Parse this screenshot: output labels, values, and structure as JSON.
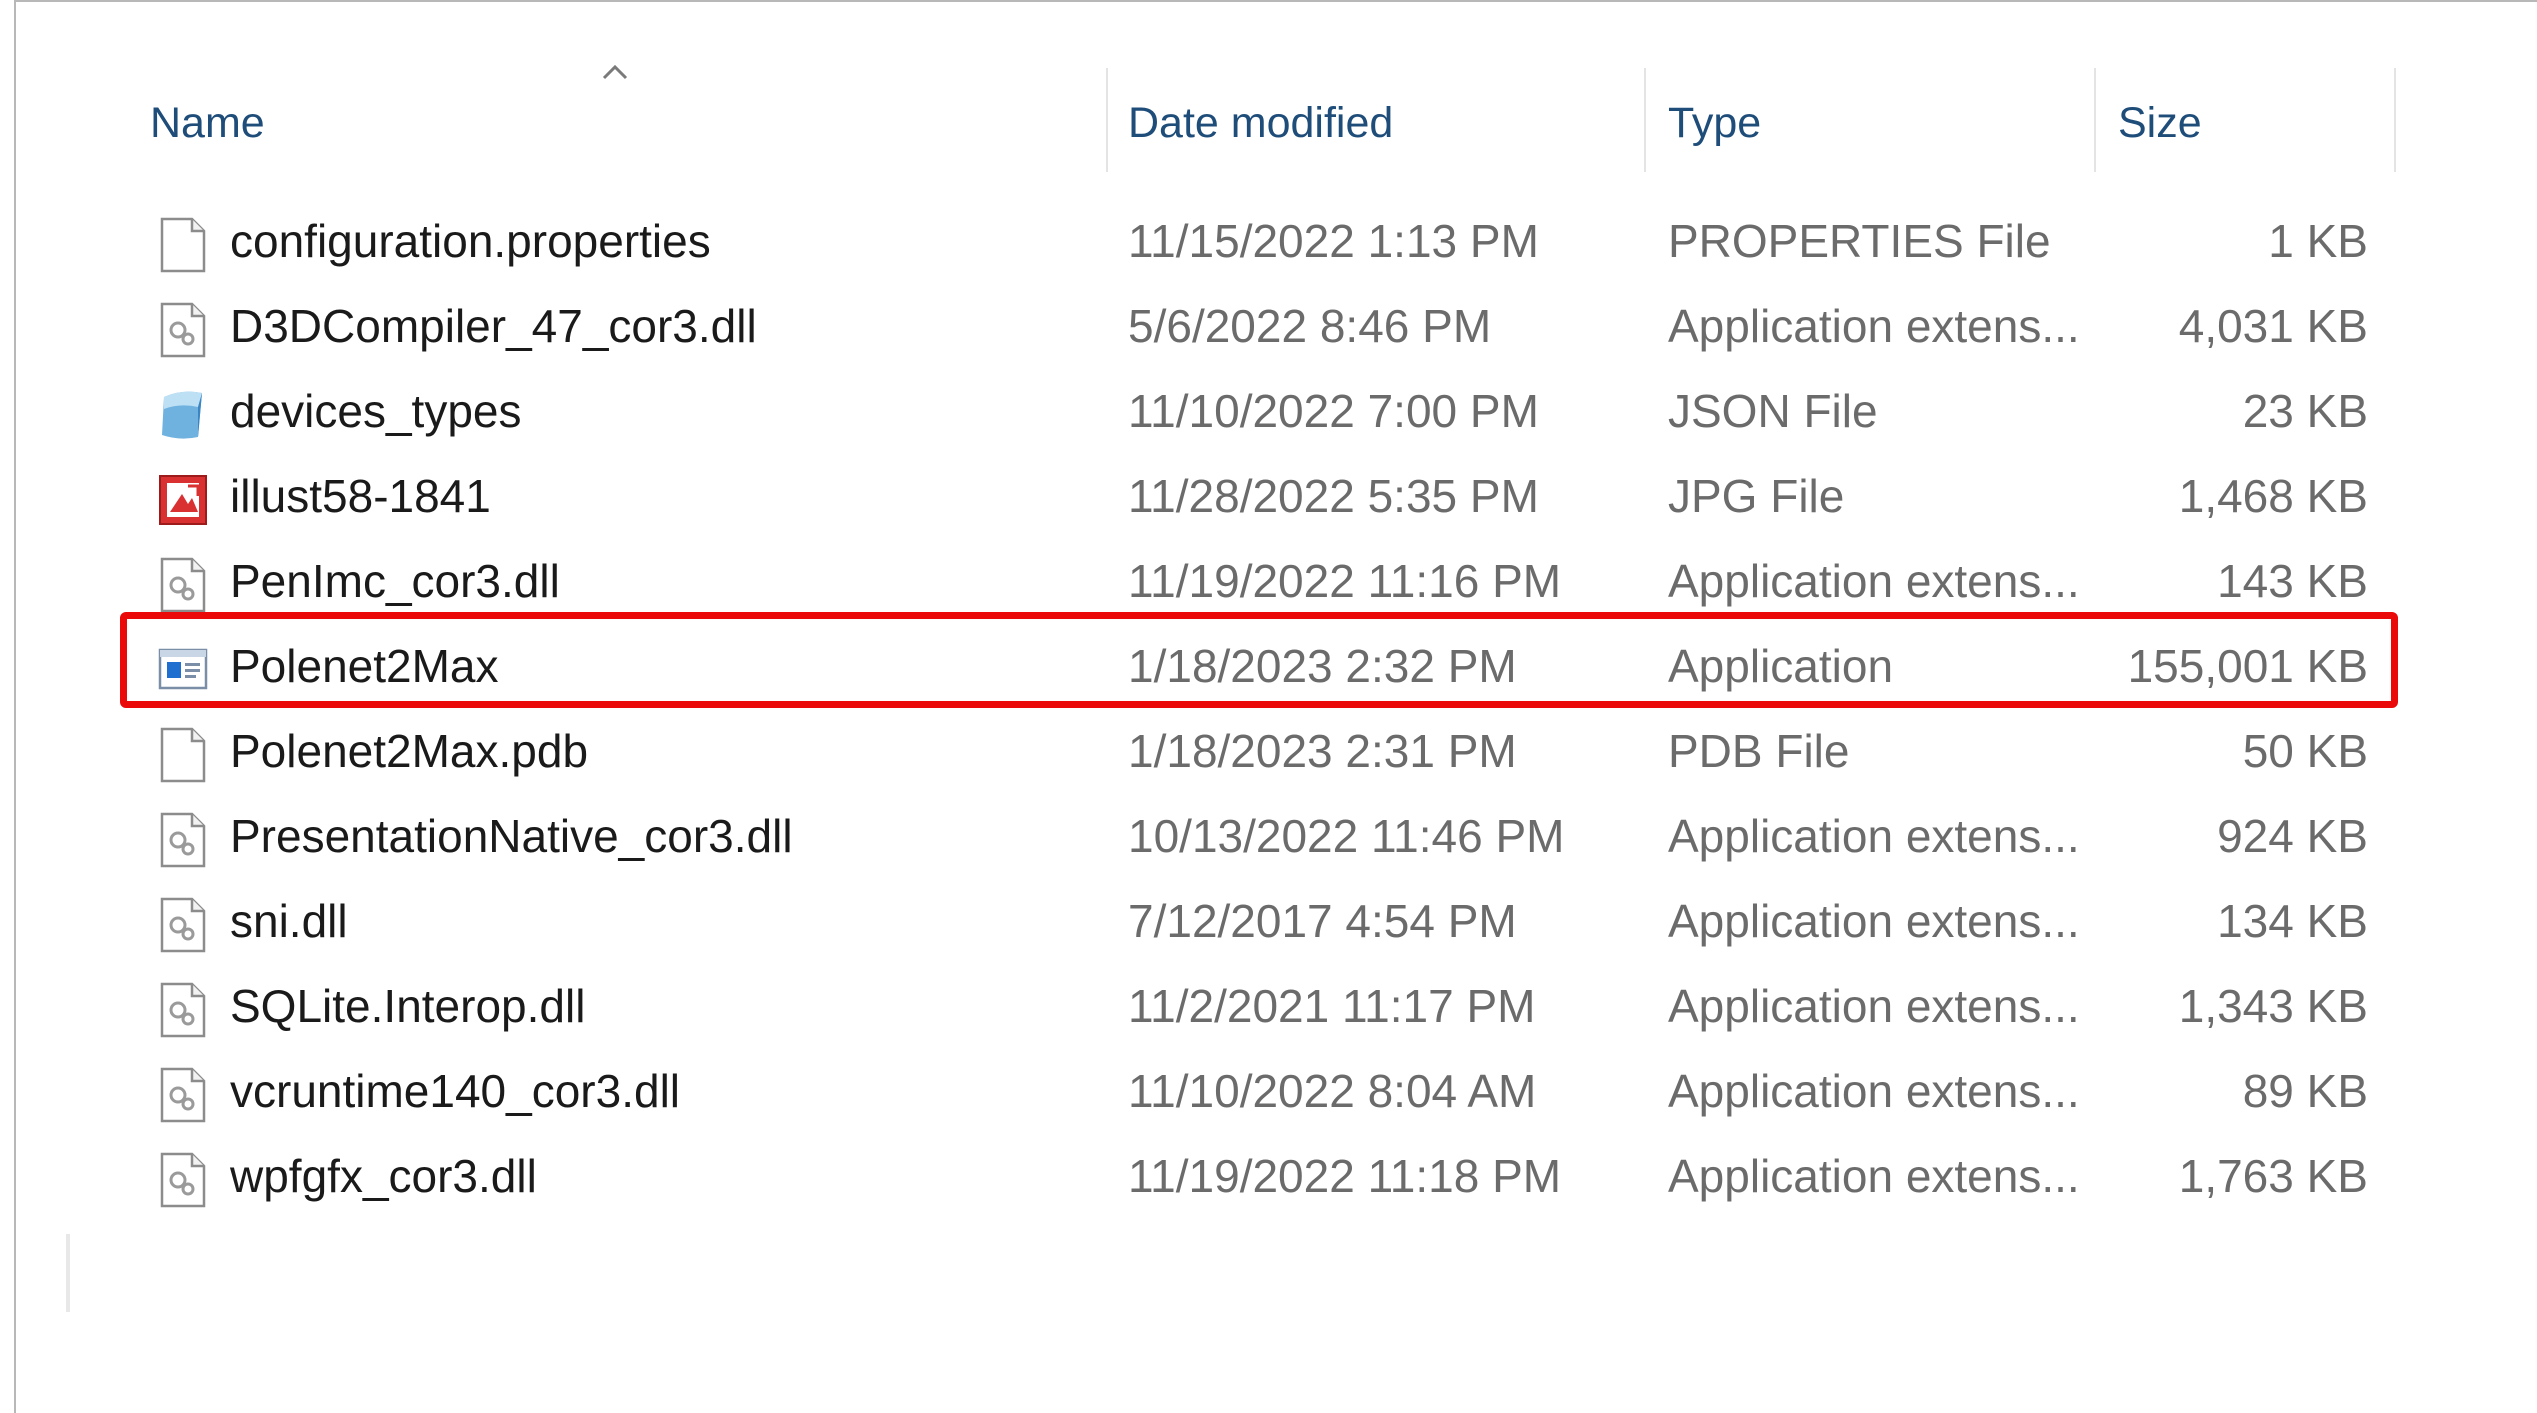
{
  "columns": {
    "name": "Name",
    "date": "Date modified",
    "type": "Type",
    "size": "Size"
  },
  "sort": {
    "column": "Name",
    "direction": "ascending",
    "icon": "chevron-up-icon"
  },
  "files": [
    {
      "name": "configuration.properties",
      "date": "11/15/2022 1:13 PM",
      "type": "PROPERTIES File",
      "size": "1 KB",
      "icon": "blank-file-icon"
    },
    {
      "name": "D3DCompiler_47_cor3.dll",
      "date": "5/6/2022 8:46 PM",
      "type": "Application extens...",
      "size": "4,031 KB",
      "icon": "dll-file-icon"
    },
    {
      "name": "devices_types",
      "date": "11/10/2022 7:00 PM",
      "type": "JSON File",
      "size": "23 KB",
      "icon": "json-file-icon"
    },
    {
      "name": "illust58-1841",
      "date": "11/28/2022 5:35 PM",
      "type": "JPG File",
      "size": "1,468 KB",
      "icon": "jpg-file-icon"
    },
    {
      "name": "PenImc_cor3.dll",
      "date": "11/19/2022 11:16 PM",
      "type": "Application extens...",
      "size": "143 KB",
      "icon": "dll-file-icon"
    },
    {
      "name": "Polenet2Max",
      "date": "1/18/2023 2:32 PM",
      "type": "Application",
      "size": "155,001 KB",
      "icon": "application-icon",
      "highlighted": true
    },
    {
      "name": "Polenet2Max.pdb",
      "date": "1/18/2023 2:31 PM",
      "type": "PDB File",
      "size": "50 KB",
      "icon": "blank-file-icon"
    },
    {
      "name": "PresentationNative_cor3.dll",
      "date": "10/13/2022 11:46 PM",
      "type": "Application extens...",
      "size": "924 KB",
      "icon": "dll-file-icon"
    },
    {
      "name": "sni.dll",
      "date": "7/12/2017 4:54 PM",
      "type": "Application extens...",
      "size": "134 KB",
      "icon": "dll-file-icon"
    },
    {
      "name": "SQLite.Interop.dll",
      "date": "11/2/2021 11:17 PM",
      "type": "Application extens...",
      "size": "1,343 KB",
      "icon": "dll-file-icon"
    },
    {
      "name": "vcruntime140_cor3.dll",
      "date": "11/10/2022 8:04 AM",
      "type": "Application extens...",
      "size": "89 KB",
      "icon": "dll-file-icon"
    },
    {
      "name": "wpfgfx_cor3.dll",
      "date": "11/19/2022 11:18 PM",
      "type": "Application extens...",
      "size": "1,763 KB",
      "icon": "dll-file-icon"
    }
  ],
  "colors": {
    "highlight": "#ea0a0a",
    "header_text": "#1f4d7a",
    "name_text": "#1a1a1a",
    "detail_text": "#6b6b6b"
  }
}
